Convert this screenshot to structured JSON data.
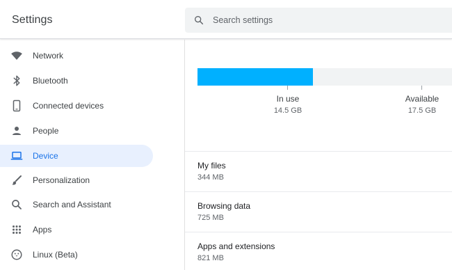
{
  "header": {
    "title": "Settings",
    "search_placeholder": "Search settings"
  },
  "sidebar": {
    "items": [
      {
        "label": "Network",
        "icon": "wifi-icon",
        "active": false
      },
      {
        "label": "Bluetooth",
        "icon": "bluetooth-icon",
        "active": false
      },
      {
        "label": "Connected devices",
        "icon": "phone-icon",
        "active": false
      },
      {
        "label": "People",
        "icon": "person-icon",
        "active": false
      },
      {
        "label": "Device",
        "icon": "laptop-icon",
        "active": true
      },
      {
        "label": "Personalization",
        "icon": "brush-icon",
        "active": false
      },
      {
        "label": "Search and Assistant",
        "icon": "search-icon",
        "active": false
      },
      {
        "label": "Apps",
        "icon": "apps-grid-icon",
        "active": false
      },
      {
        "label": "Linux (Beta)",
        "icon": "linux-penguin-icon",
        "active": false
      }
    ]
  },
  "storage": {
    "in_use_label": "In use",
    "in_use_value": "14.5 GB",
    "available_label": "Available",
    "available_value": "17.5 GB",
    "used_fraction": 0.453,
    "colors": {
      "fill": "#00b0ff",
      "track": "#f1f3f4",
      "accent": "#1a73e8"
    },
    "rows": [
      {
        "title": "My files",
        "value": "344 MB"
      },
      {
        "title": "Browsing data",
        "value": "725 MB"
      },
      {
        "title": "Apps and extensions",
        "value": "821 MB"
      }
    ]
  }
}
